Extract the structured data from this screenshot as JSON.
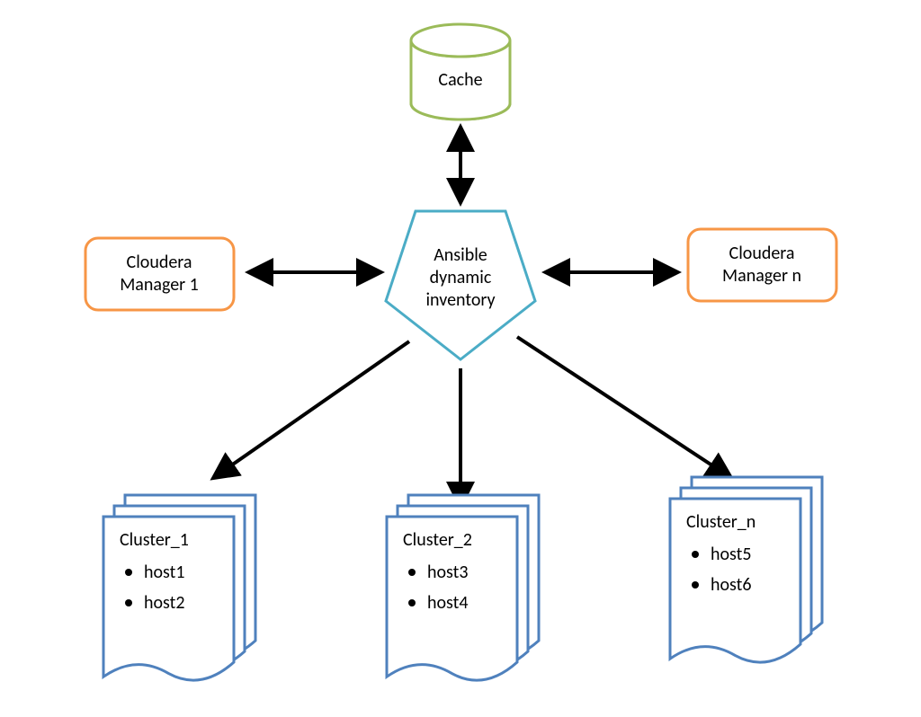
{
  "cache": {
    "label": "Cache"
  },
  "center": {
    "line1": "Ansible",
    "line2": "dynamic",
    "line3": "inventory"
  },
  "managers": {
    "left": {
      "line1": "Cloudera",
      "line2": "Manager 1"
    },
    "right": {
      "line1": "Cloudera",
      "line2": "Manager n"
    }
  },
  "clusters": [
    {
      "title": "Cluster_1",
      "hosts": [
        "host1",
        "host2"
      ]
    },
    {
      "title": "Cluster_2",
      "hosts": [
        "host3",
        "host4"
      ]
    },
    {
      "title": "Cluster_n",
      "hosts": [
        "host5",
        "host6"
      ]
    }
  ],
  "colors": {
    "cache": "#9bbb59",
    "manager": "#f79646",
    "center": "#4bacc6",
    "cluster": "#4f81bd",
    "arrow": "#000000"
  }
}
